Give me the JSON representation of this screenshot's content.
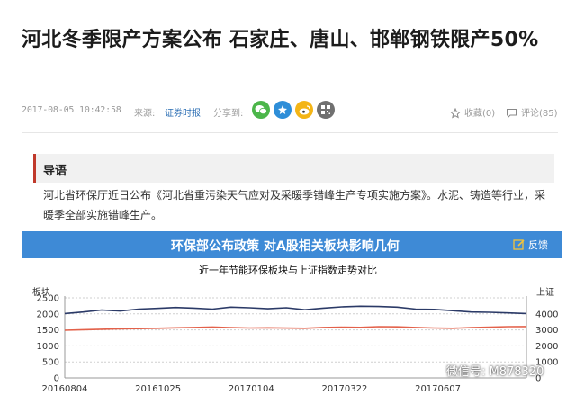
{
  "article": {
    "title": "河北冬季限产方案公布 石家庄、唐山、邯郸钢铁限产50%",
    "datetime": "2017-08-05 10:42:58",
    "source_label": "来源:",
    "source": "证券时报",
    "share_label": "分享到:",
    "share_icons": [
      "wechat-icon",
      "qzone-icon",
      "weibo-icon",
      "qrcode-icon"
    ],
    "favorite": "收藏(0)",
    "comments": "评论(85)"
  },
  "guide": {
    "label": "导语",
    "summary": "河北省环保厅近日公布《河北省重污染天气应对及采暖季错峰生产专项实施方案》。水泥、铸造等行业，采暖季全部实施错峰生产。"
  },
  "banner": {
    "title": "环保部公布政策 对A股相关板块影响几何",
    "feedback": "反馈",
    "color": "#3e8ad6"
  },
  "watermark": "微信号: M878320",
  "chart_data": {
    "type": "line",
    "title": "近一年节能环保板块与上证指数走势对比",
    "left_axis_label": "板块",
    "right_axis_label": "上证",
    "x_ticks": [
      "20160804",
      "20161025",
      "20170104",
      "20170322",
      "20170607"
    ],
    "x_range": [
      0,
      250
    ],
    "ylim_left": [
      0,
      2500
    ],
    "yticks_left": [
      0,
      500,
      1000,
      1500,
      2000,
      2500
    ],
    "ylim_right": [
      0,
      5000
    ],
    "yticks_right": [
      0,
      1000,
      2000,
      3000,
      4000
    ],
    "series": [
      {
        "axis": "left",
        "color": "#2b3a67",
        "x": [
          0,
          10,
          20,
          30,
          40,
          50,
          60,
          70,
          80,
          90,
          100,
          110,
          120,
          130,
          140,
          150,
          160,
          170,
          180,
          190,
          200,
          210,
          220,
          230,
          240,
          250
        ],
        "values": [
          2010,
          2060,
          2120,
          2090,
          2150,
          2170,
          2200,
          2180,
          2150,
          2210,
          2190,
          2160,
          2190,
          2130,
          2180,
          2220,
          2240,
          2230,
          2210,
          2150,
          2140,
          2100,
          2060,
          2050,
          2030,
          2010
        ]
      },
      {
        "axis": "right",
        "color": "#e3614a",
        "x": [
          0,
          10,
          20,
          30,
          40,
          50,
          60,
          70,
          80,
          90,
          100,
          110,
          120,
          130,
          140,
          150,
          160,
          170,
          180,
          190,
          200,
          210,
          220,
          230,
          240,
          250
        ],
        "values": [
          2980,
          3010,
          3040,
          3060,
          3080,
          3100,
          3130,
          3150,
          3180,
          3140,
          3120,
          3130,
          3110,
          3100,
          3150,
          3170,
          3160,
          3200,
          3190,
          3150,
          3120,
          3100,
          3140,
          3170,
          3200,
          3210
        ]
      }
    ]
  }
}
